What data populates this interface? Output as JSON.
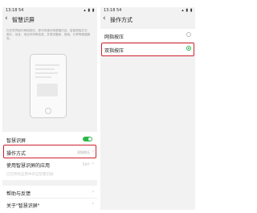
{
  "status_bar": {
    "time": "13:18 54",
    "icons": "▴ ▮ ▮"
  },
  "left_screen": {
    "back_icon": "back-arrow-icon",
    "title": "智慧识屏",
    "description": "在任意界面中两指按压，即可快速识别屏幕内容，智能提取文字、图片、地址、电话号码等信息，并提供翻译、搜索、分享等便捷服务。",
    "settings": [
      {
        "label": "智慧识屏",
        "type": "toggle",
        "on": true
      },
      {
        "label": "操作方式",
        "value": "双指按压",
        "type": "link",
        "highlighted": true
      },
      {
        "label": "使用智慧识屏的应用",
        "value": "54个",
        "type": "link"
      },
      {
        "label": "已在所有应用中开启智慧识屏",
        "type": "info",
        "disabled": true
      }
    ],
    "footer_links": [
      {
        "label": "帮助与反馈"
      },
      {
        "label": "关于\"智慧识屏\""
      }
    ]
  },
  "right_screen": {
    "back_icon": "back-arrow-icon",
    "title": "操作方式",
    "options": [
      {
        "label": "网指按压",
        "selected": false,
        "highlighted": false
      },
      {
        "label": "双指按压",
        "selected": true,
        "highlighted": true
      }
    ]
  },
  "colors": {
    "accent_green": "#2db84b",
    "highlight_red": "#d0202d",
    "background": "#f2f2f2"
  }
}
